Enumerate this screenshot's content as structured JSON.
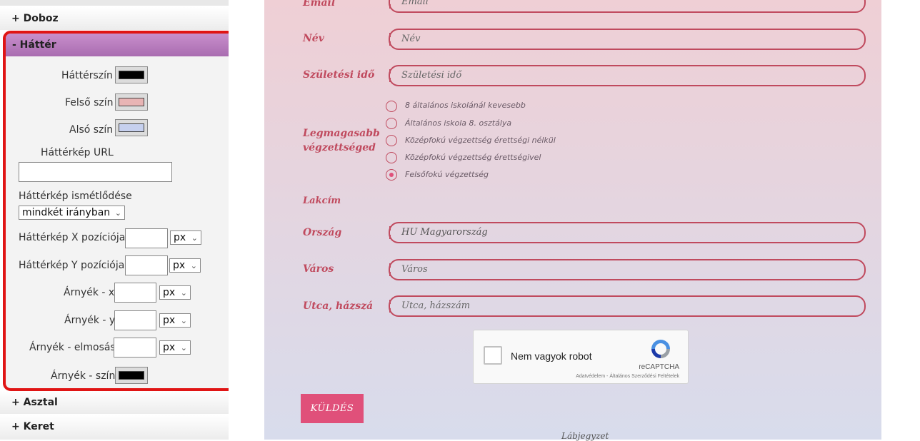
{
  "panel": {
    "sections": {
      "doboz": "+ Doboz",
      "hatter": "- Háttér",
      "asztal": "+ Asztal",
      "keret": "+ Keret"
    },
    "fields": {
      "bg_color_label": "Háttérszín",
      "top_color_label": "Felső szín",
      "bottom_color_label": "Alsó szín",
      "bg_image_url_label": "Háttérkép URL",
      "bg_image_url_value": "",
      "bg_repeat_label": "Háttérkép ismétlődése",
      "bg_repeat_value": "mindkét irányban",
      "bg_x_label": "Háttérkép X pozíciója",
      "bg_x_value": "",
      "bg_x_unit": "px",
      "bg_y_label": "Háttérkép Y pozíciója",
      "bg_y_value": "",
      "bg_y_unit": "px",
      "shadow_x_label": "Árnyék - x",
      "shadow_x_value": "",
      "shadow_x_unit": "px",
      "shadow_y_label": "Árnyék - y",
      "shadow_y_value": "",
      "shadow_y_unit": "px",
      "shadow_blur_label": "Árnyék - elmosás",
      "shadow_blur_value": "",
      "shadow_blur_unit": "px",
      "shadow_color_label": "Árnyék - szín"
    },
    "colors": {
      "bg_color": "#000000",
      "top_color": "#e8b4b4",
      "bottom_color": "#c6d0ee",
      "shadow_color": "#000000",
      "highlight_border": "#e01515",
      "section_header": "#b67cbb"
    }
  },
  "form": {
    "email_label": "Email",
    "email_placeholder": "Email",
    "name_label": "Név",
    "name_placeholder": "Név",
    "birth_label": "Születési idő",
    "birth_placeholder": "Születési idő",
    "education_label_1": "Legmagasabb",
    "education_label_2": "végzettséged",
    "education_options": [
      "8 általános iskolánál kevesebb",
      "Általános iskola 8. osztálya",
      "Középfokú végzettség érettségi nélkül",
      "Középfokú végzettség érettségivel",
      "Felsőfokú végzettség"
    ],
    "education_selected": 4,
    "address_label": "Lakcím",
    "country_label": "Ország",
    "country_value": "HU Magyarország",
    "city_label": "Város",
    "city_placeholder": "Város",
    "street_label": "Utca, házszám",
    "street_placeholder": "Utca, házszám",
    "captcha": {
      "text": "Nem vagyok robot",
      "brand": "reCAPTCHA",
      "links": "Adatvédelem - Általános Szerződési Feltételek"
    },
    "submit_label": "KÜLDÉS",
    "footer_text": "Lábjegyzet",
    "accent": "#c04a5e",
    "button_color": "#e0507a"
  }
}
